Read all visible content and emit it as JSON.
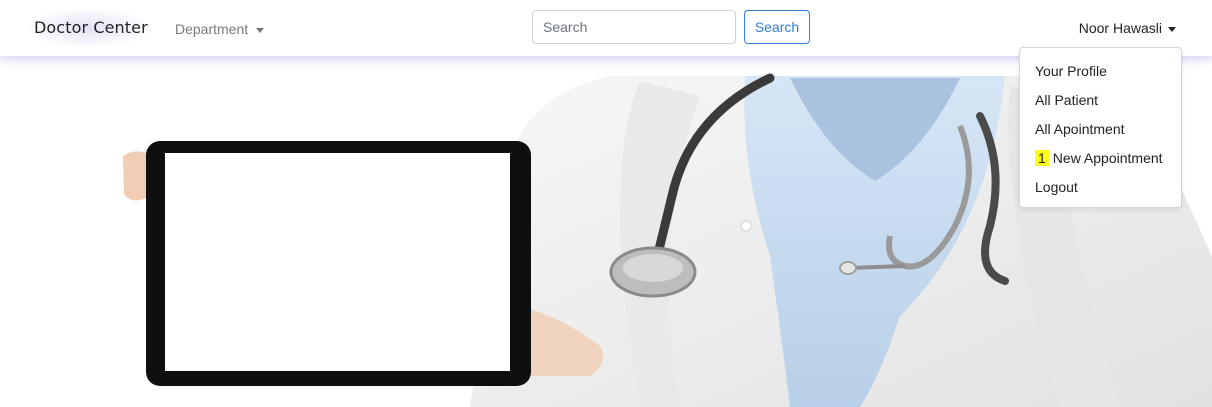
{
  "navbar": {
    "brand": "Doctor Center",
    "department_label": "Department",
    "search": {
      "placeholder": "Search",
      "button_label": "Search"
    },
    "user_name": "Noor Hawasli"
  },
  "user_menu": {
    "items": [
      {
        "label": "Your Profile"
      },
      {
        "label": "All Patient"
      },
      {
        "label": "All Apointment"
      },
      {
        "count": "1",
        "label": "New Appointment"
      },
      {
        "label": "Logout"
      }
    ]
  },
  "colors": {
    "accent": "#2f7ed8",
    "badge_highlight": "#fdff1a",
    "scrub_blue": "#c7dcf0",
    "coat_white": "#f3f3f3"
  },
  "hero": {
    "image_subject": "doctor-holding-tablet-with-stethoscope"
  }
}
